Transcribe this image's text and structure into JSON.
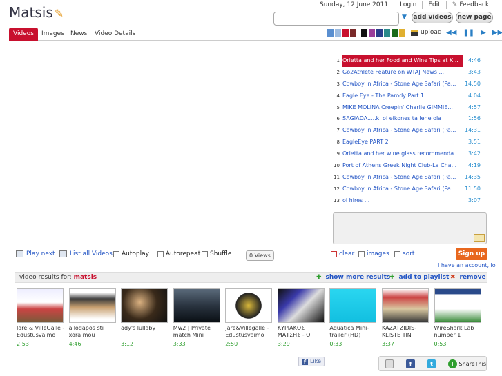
{
  "header": {
    "logo": "Matsis",
    "date": "Sunday, 12 June 2011",
    "login": "Login",
    "edit": "Edit",
    "feedback": "Feedback",
    "search_value": "",
    "add_videos": "add videos",
    "new_page": "new page"
  },
  "tabs": [
    "Videos",
    "Images",
    "News",
    "Video Details"
  ],
  "active_tab": "Videos",
  "toolbar": {
    "upload": "upload",
    "swatches": [
      "#5a8fd0",
      "#9dbbe0",
      "#c8102e",
      "#7a2a2a",
      "#111111",
      "#9a3e9a",
      "#2a3e8a",
      "#2a8a8a",
      "#1a6a1a",
      "#e0b030"
    ]
  },
  "playlist": [
    {
      "num": "1",
      "title": "Orietta and her Food and Wine Tips at K...",
      "dur": "4:46"
    },
    {
      "num": "2",
      "title": "Go2Athlete Feature on WTAJ News        ...",
      "dur": "3:43"
    },
    {
      "num": "3",
      "title": "Cowboy in Africa - Stone Age Safari (Pa...",
      "dur": "14:50"
    },
    {
      "num": "4",
      "title": "Eagle Eye - The Parody Part 1",
      "dur": "4:04"
    },
    {
      "num": "5",
      "title": "MIKE MOLINA Creepin' Charlie GIMMIE...",
      "dur": "4:57"
    },
    {
      "num": "6",
      "title": "SAGIADA.....ki oi eikones ta lene ola",
      "dur": "1:56"
    },
    {
      "num": "7",
      "title": "Cowboy in Africa - Stone Age Safari (Pa...",
      "dur": "14:31"
    },
    {
      "num": "8",
      "title": "EagleEye PART 2",
      "dur": "3:51"
    },
    {
      "num": "9",
      "title": "Orietta and her wine glass recommenda...",
      "dur": "3:42"
    },
    {
      "num": "10",
      "title": "Port of Athens Greek Night Club-La Cha...",
      "dur": "4:19"
    },
    {
      "num": "11",
      "title": "Cowboy in Africa - Stone Age Safari (Pa...",
      "dur": "14:35"
    },
    {
      "num": "12",
      "title": "Cowboy in Africa - Stone Age Safari (Pa...",
      "dur": "11:50"
    },
    {
      "num": "13",
      "title": "oi hires                                ...",
      "dur": "3:07"
    }
  ],
  "controls": {
    "play_next": "Play next",
    "list_all": "List all Videos",
    "autoplay": "Autoplay",
    "autorepeat": "Autorepeat",
    "shuffle": "Shuffle",
    "views": "0 Views",
    "clear": "clear",
    "images": "images",
    "sort": "sort",
    "signup": "Sign up",
    "have_account": "I have an account, lo"
  },
  "results": {
    "label": "video results for:",
    "query": "matsis",
    "show_more": "show more results",
    "add_playlist": "add to playlist",
    "remove": "remove",
    "items": [
      {
        "title": "Jare & VilleGalle - Edustusvaimo",
        "dur": "2:53"
      },
      {
        "title": "allodapos sti xora mou",
        "dur": "4:46"
      },
      {
        "title": "ady's lullaby",
        "dur": "3:12"
      },
      {
        "title": "Mw2 | Private match Mini",
        "dur": "3:33"
      },
      {
        "title": "Jare&Villegalle - Edustusvaimo",
        "dur": "2:50"
      },
      {
        "title": "ΚΥΡΙΑΚΟΣ ΜΑΤΣΗΣ - Ο",
        "dur": "3:29"
      },
      {
        "title": "Aquatica Mini-trailer (HD)",
        "dur": "0:33"
      },
      {
        "title": "KAZATZIDIS-KLISTE TIN",
        "dur": "3:37"
      },
      {
        "title": "WireShark Lab number 1",
        "dur": "0:53"
      }
    ]
  },
  "social": {
    "like": "Like",
    "sharethis": "ShareThis"
  }
}
